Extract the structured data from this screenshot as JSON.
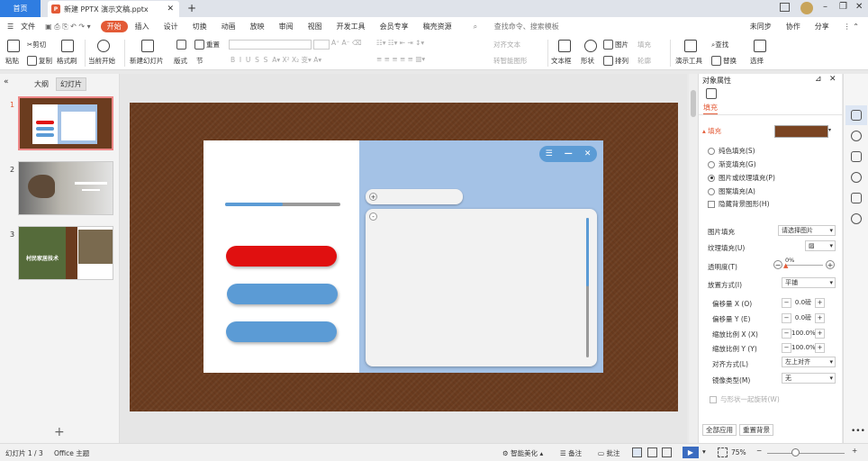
{
  "tabs": {
    "home": "首页",
    "doc": "新建 PPTX 演示文稿.pptx",
    "add": "+"
  },
  "menu": {
    "file": "文件",
    "items": [
      "开始",
      "插入",
      "设计",
      "切换",
      "动画",
      "放映",
      "审阅",
      "视图",
      "开发工具",
      "会员专享",
      "稿壳资源"
    ],
    "search": "查找命令、搜索模板",
    "sync": "未同步",
    "collab": "协作",
    "share": "分享"
  },
  "ribbon": {
    "paste": "粘贴",
    "cut": "剪切",
    "copy": "复制",
    "format_painter": "格式刷",
    "from_current": "当前开始",
    "new_slide": "新建幻灯片",
    "layout": "版式",
    "section": "节",
    "reset": "重置",
    "align_text": "对齐文本",
    "smartart": "转智能图形",
    "textbox": "文本框",
    "shape": "形状",
    "picture": "图片",
    "fill": "填充",
    "arrange": "排列",
    "outline": "轮廓",
    "present_tool": "演示工具",
    "find": "查找",
    "replace": "替换",
    "select": "选择"
  },
  "left": {
    "tab_outline": "大纲",
    "tab_slides": "幻灯片",
    "slides": [
      "1",
      "2",
      "3"
    ],
    "add": "+",
    "slide3_text": "村民家居技术"
  },
  "right": {
    "title": "对象属性",
    "fill_tab": "填充",
    "section": "填充",
    "options": [
      {
        "label": "纯色填充(S)",
        "on": false
      },
      {
        "label": "渐变填充(G)",
        "on": false
      },
      {
        "label": "图片或纹理填充(P)",
        "on": true
      },
      {
        "label": "图案填充(A)",
        "on": false
      }
    ],
    "hide_bg": "隐藏背景图形(H)",
    "pic_fill": "图片填充",
    "pic_fill_val": "请选择图片",
    "tex_fill": "纹理填充(U)",
    "transparency": "透明度(T)",
    "transparency_val": "0%",
    "place": "放置方式(I)",
    "place_val": "平铺",
    "offset_x": "偏移量 X (O)",
    "offset_x_val": "0.0磅",
    "offset_y": "偏移量 Y (E)",
    "offset_y_val": "0.0磅",
    "scale_x": "缩放比例 X (X)",
    "scale_x_val": "100.0%",
    "scale_y": "缩放比例 Y (Y)",
    "scale_y_val": "100.0%",
    "align": "对齐方式(L)",
    "align_val": "左上对齐",
    "mirror": "镜像类型(M)",
    "mirror_val": "无",
    "rotate": "与形状一起旋转(W)",
    "apply_all": "全部应用",
    "reset_bg": "重置背景"
  },
  "status": {
    "slide": "幻灯片 1 / 3",
    "theme": "Office 主题",
    "beautify": "智能美化",
    "notes": "备注",
    "comments": "批注",
    "zoom": "75%"
  },
  "colors": {
    "accent": "#2f7de1",
    "red": "#e01010",
    "blue": "#5b9bd5",
    "panel": "#a4c2e6"
  }
}
